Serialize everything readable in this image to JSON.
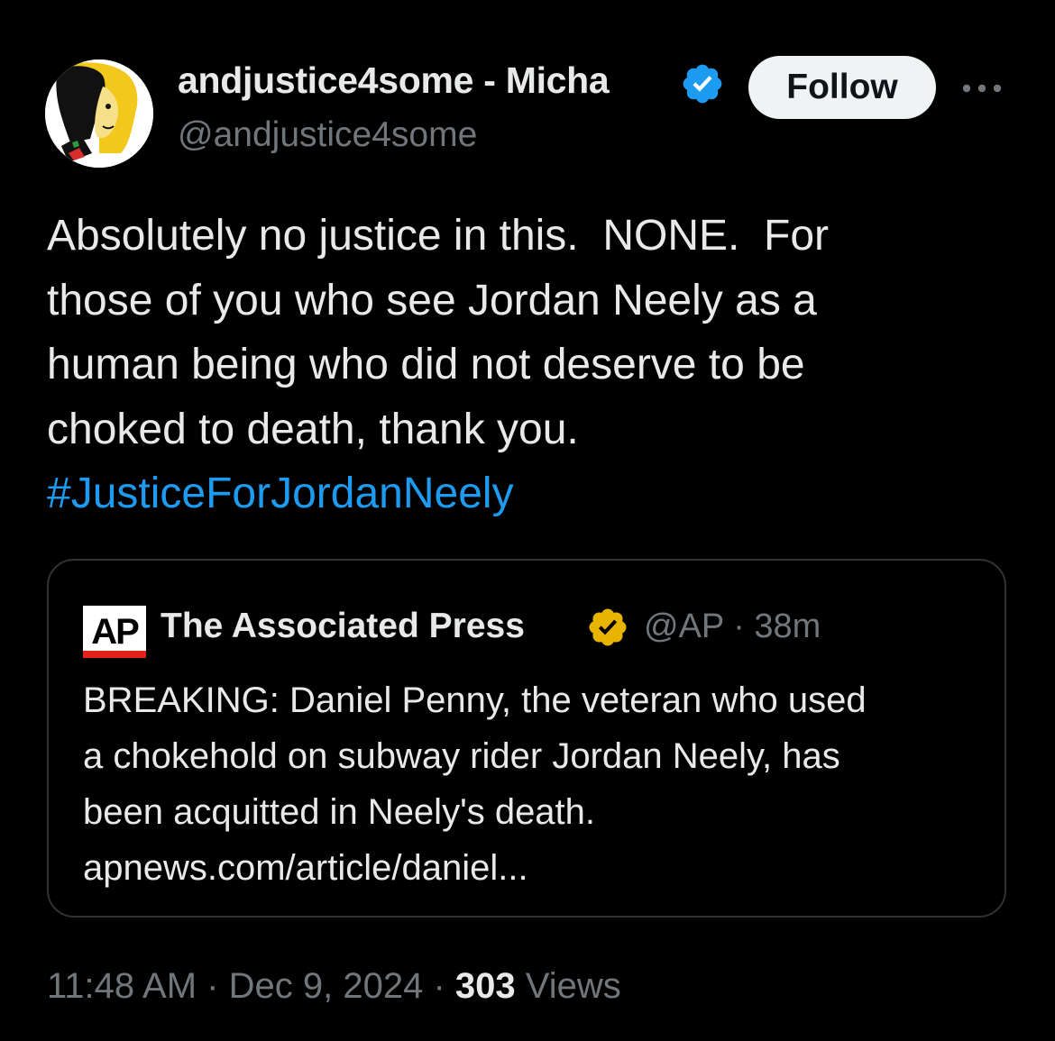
{
  "author": {
    "display_name": "andjustice4some - Micha",
    "handle": "@andjustice4some",
    "verified_color": "#1d9bf0",
    "avatar_icon": "user-avatar"
  },
  "follow_button": {
    "label": "Follow"
  },
  "more_button": {
    "icon": "more-horizontal-icon"
  },
  "tweet": {
    "lines": [
      "Absolutely no justice in this.  NONE.  For",
      "those of you who see Jordan Neely as a",
      "human being who did not deserve to be",
      "choked to death, thank you."
    ],
    "hashtag": "#JusticeForJordanNeely",
    "hashtag_color": "#1d9bf0"
  },
  "quoted_tweet": {
    "logo_text": "AP",
    "name": "The Associated Press",
    "badge_color": "#e8b400",
    "handle": "@AP",
    "separator": "·",
    "time": "38m",
    "lines": [
      "BREAKING: Daniel Penny, the veteran who used",
      "a chokehold on subway rider Jordan Neely, has",
      "been acquitted in Neely's death.",
      "apnews.com/article/daniel..."
    ]
  },
  "footer": {
    "time": "11:48 AM",
    "separator": "·",
    "date": "Dec 9, 2024",
    "views_count": "303",
    "views_label": "Views"
  }
}
